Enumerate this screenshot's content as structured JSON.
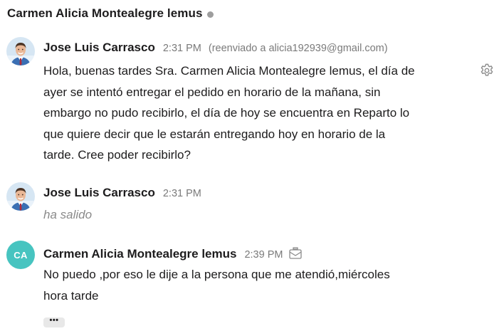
{
  "header": {
    "title": "Carmen Alicia Montealegre lemus",
    "status_color": "#9e9e9e"
  },
  "messages": [
    {
      "sender": "Jose Luis Carrasco",
      "time": "2:31 PM",
      "forwarded_note": "(reenviado a alicia192939@gmail.com)",
      "lines": [
        "Hola, buenas tardes Sra. Carmen Alicia Montealegre lemus, el día de",
        "ayer se intentó entregar el pedido en horario de la mañana, sin",
        "embargo no pudo recibirlo, el día de hoy se encuentra en Reparto lo",
        "que quiere decir que le estarán entregando hoy en horario de la",
        "tarde. Cree poder recibirlo?"
      ],
      "icon": "gear-icon"
    },
    {
      "sender": "Jose Luis Carrasco",
      "time": "2:31 PM",
      "lines": [
        "ha salido"
      ]
    },
    {
      "sender": "Carmen Alicia Montealegre lemus",
      "avatar_initials": "CA",
      "avatar_color": "#47c4c0",
      "time": "2:39 PM",
      "icon": "email-icon",
      "lines": [
        "No puedo ,por eso le dije a la persona que me atendió,miércoles",
        "hora tarde"
      ]
    }
  ],
  "more_button_label": "•••"
}
